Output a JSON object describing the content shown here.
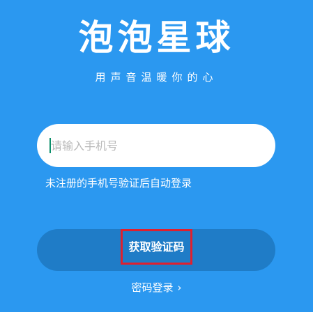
{
  "app": {
    "title": "泡泡星球",
    "slogan": "用声音温暖你的心"
  },
  "login": {
    "phone_placeholder": "请输入手机号",
    "hint": "未注册的手机号验证后自动登录",
    "get_code_label": "获取验证码",
    "password_login_label": "密码登录",
    "password_login_arrow": "›"
  },
  "colors": {
    "background": "#2b98f0",
    "button": "#1f7cc7",
    "highlight_border": "#e0202e"
  }
}
